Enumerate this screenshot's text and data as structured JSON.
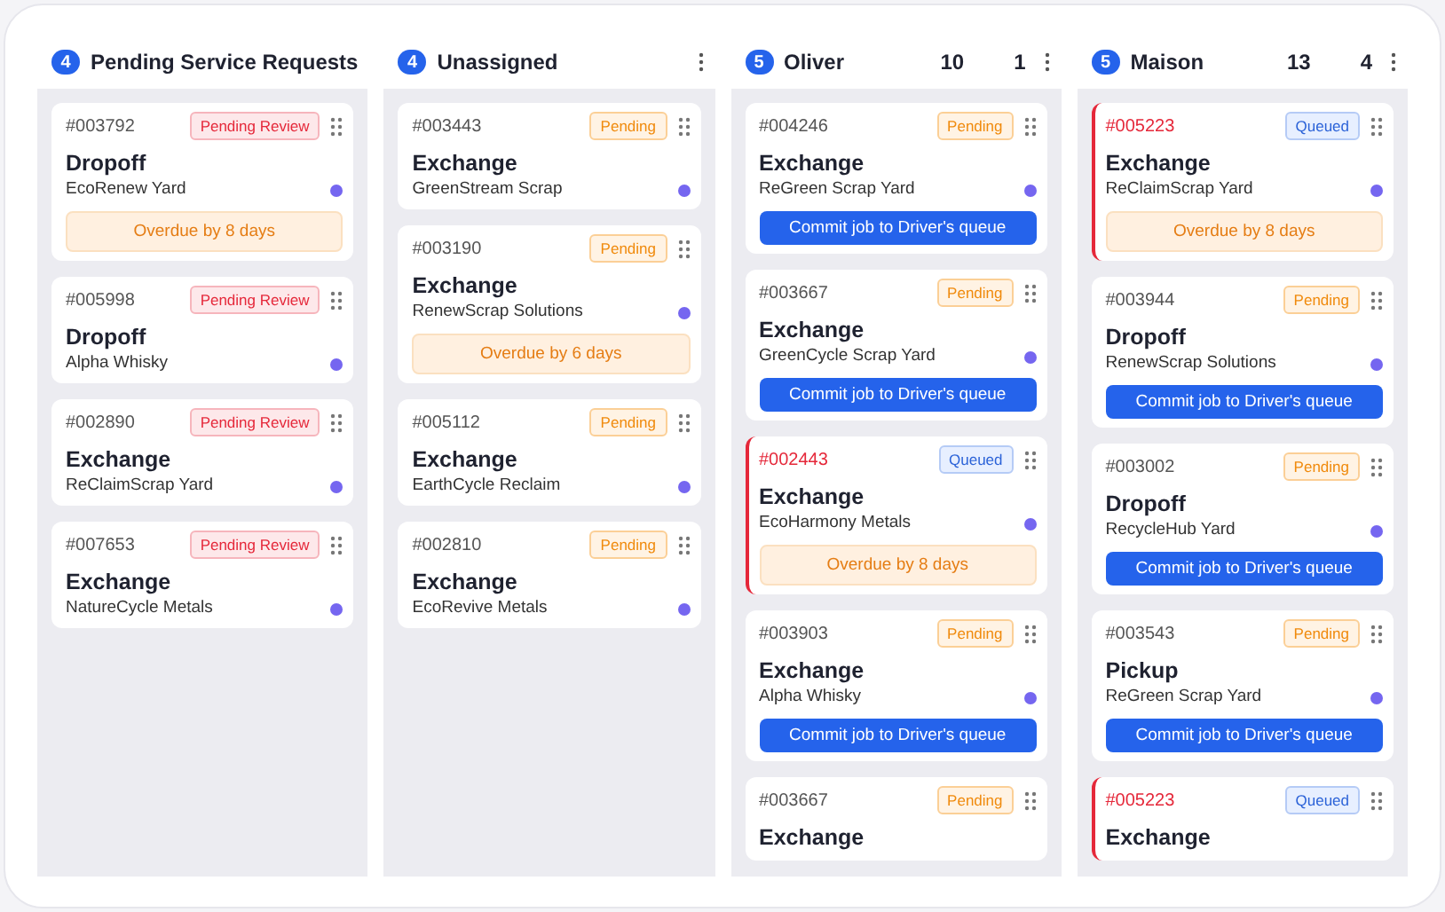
{
  "columns": [
    {
      "count": "4",
      "title": "Pending Service Requests",
      "cards": [
        {
          "id": "#003792",
          "overdue": false,
          "status": {
            "kind": "review",
            "label": "Pending Review"
          },
          "title": "Dropoff",
          "company": "EcoRenew Yard",
          "footer": {
            "kind": "overdue",
            "text": "Overdue by 8 days"
          }
        },
        {
          "id": "#005998",
          "overdue": false,
          "status": {
            "kind": "review",
            "label": "Pending Review"
          },
          "title": "Dropoff",
          "company": "Alpha Whisky"
        },
        {
          "id": "#002890",
          "overdue": false,
          "status": {
            "kind": "review",
            "label": "Pending Review"
          },
          "title": "Exchange",
          "company": "ReClaimScrap Yard"
        },
        {
          "id": "#007653",
          "overdue": false,
          "status": {
            "kind": "review",
            "label": "Pending Review"
          },
          "title": "Exchange",
          "company": "NatureCycle Metals"
        }
      ]
    },
    {
      "count": "4",
      "title": "Unassigned",
      "cards": [
        {
          "id": "#003443",
          "overdue": false,
          "status": {
            "kind": "pending",
            "label": "Pending"
          },
          "title": "Exchange",
          "company": "GreenStream Scrap"
        },
        {
          "id": "#003190",
          "overdue": false,
          "status": {
            "kind": "pending",
            "label": "Pending"
          },
          "title": "Exchange",
          "company": "RenewScrap Solutions",
          "footer": {
            "kind": "overdue",
            "text": "Overdue by 6 days"
          }
        },
        {
          "id": "#005112",
          "overdue": false,
          "status": {
            "kind": "pending",
            "label": "Pending"
          },
          "title": "Exchange",
          "company": "EarthCycle Reclaim"
        },
        {
          "id": "#002810",
          "overdue": false,
          "status": {
            "kind": "pending",
            "label": "Pending"
          },
          "title": "Exchange",
          "company": "EcoRevive Metals"
        }
      ]
    },
    {
      "count": "5",
      "title": "Oliver",
      "stat_1": "10",
      "stat_2": "1",
      "cards": [
        {
          "id": "#004246",
          "overdue": false,
          "status": {
            "kind": "pending",
            "label": "Pending"
          },
          "title": "Exchange",
          "company": "ReGreen Scrap Yard",
          "footer": {
            "kind": "commit",
            "text": "Commit job to Driver's queue"
          }
        },
        {
          "id": "#003667",
          "overdue": false,
          "status": {
            "kind": "pending",
            "label": "Pending"
          },
          "title": "Exchange",
          "company": "GreenCycle Scrap Yard",
          "footer": {
            "kind": "commit",
            "text": "Commit job to Driver's queue"
          }
        },
        {
          "id": "#002443",
          "overdue": true,
          "status": {
            "kind": "queued",
            "label": "Queued"
          },
          "title": "Exchange",
          "company": "EcoHarmony Metals",
          "footer": {
            "kind": "overdue",
            "text": "Overdue by 8 days"
          }
        },
        {
          "id": "#003903",
          "overdue": false,
          "status": {
            "kind": "pending",
            "label": "Pending"
          },
          "title": "Exchange",
          "company": "Alpha Whisky",
          "footer": {
            "kind": "commit",
            "text": "Commit job to Driver's queue"
          }
        },
        {
          "id": "#003667",
          "overdue": false,
          "status": {
            "kind": "pending",
            "label": "Pending"
          },
          "title": "Exchange"
        }
      ]
    },
    {
      "count": "5",
      "title": "Maison",
      "stat_1": "13",
      "stat_2": "4",
      "cards": [
        {
          "id": "#005223",
          "overdue": true,
          "status": {
            "kind": "queued",
            "label": "Queued"
          },
          "title": "Exchange",
          "company": "ReClaimScrap Yard",
          "footer": {
            "kind": "overdue",
            "text": "Overdue by 8 days"
          }
        },
        {
          "id": "#003944",
          "overdue": false,
          "status": {
            "kind": "pending",
            "label": "Pending"
          },
          "title": "Dropoff",
          "company": "RenewScrap Solutions",
          "footer": {
            "kind": "commit",
            "text": "Commit job to Driver's queue"
          }
        },
        {
          "id": "#003002",
          "overdue": false,
          "status": {
            "kind": "pending",
            "label": "Pending"
          },
          "title": "Dropoff",
          "company": "RecycleHub Yard",
          "footer": {
            "kind": "commit",
            "text": "Commit job to Driver's queue"
          }
        },
        {
          "id": "#003543",
          "overdue": false,
          "status": {
            "kind": "pending",
            "label": "Pending"
          },
          "title": "Pickup",
          "company": "ReGreen Scrap Yard",
          "footer": {
            "kind": "commit",
            "text": "Commit job to Driver's queue"
          }
        },
        {
          "id": "#005223",
          "overdue": true,
          "status": {
            "kind": "queued",
            "label": "Queued"
          },
          "title": "Exchange"
        }
      ]
    }
  ]
}
